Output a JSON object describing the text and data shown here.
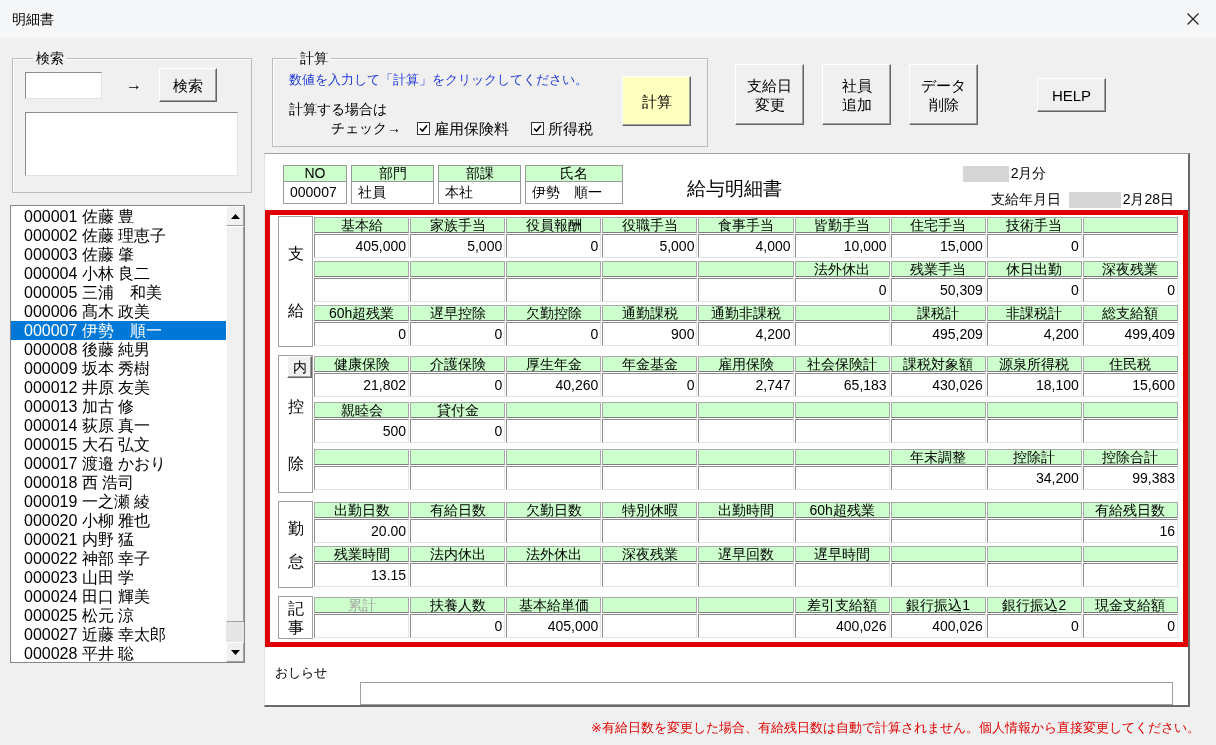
{
  "window": {
    "title": "明細書"
  },
  "search": {
    "title": "検索",
    "arrow": "→",
    "button": "検索"
  },
  "employees": [
    {
      "label": "000001 佐藤 豊",
      "selected": false
    },
    {
      "label": "000002 佐藤 理恵子",
      "selected": false
    },
    {
      "label": "000003 佐藤 肇",
      "selected": false
    },
    {
      "label": "000004 小林 良二",
      "selected": false
    },
    {
      "label": "000005 三浦　和美",
      "selected": false
    },
    {
      "label": "000006 髙木 政美",
      "selected": false
    },
    {
      "label": "000007 伊勢　順一",
      "selected": true
    },
    {
      "label": "000008 後藤 純男",
      "selected": false
    },
    {
      "label": "000009 坂本 秀樹",
      "selected": false
    },
    {
      "label": "000012 井原 友美",
      "selected": false
    },
    {
      "label": "000013 加古 修",
      "selected": false
    },
    {
      "label": "000014 荻原 真一",
      "selected": false
    },
    {
      "label": "000015 大石 弘文",
      "selected": false
    },
    {
      "label": "000017 渡邉 かおり",
      "selected": false
    },
    {
      "label": "000018 西 浩司",
      "selected": false
    },
    {
      "label": "000019 一之瀬 綾",
      "selected": false
    },
    {
      "label": "000020 小柳 雅也",
      "selected": false
    },
    {
      "label": "000021 内野 猛",
      "selected": false
    },
    {
      "label": "000022 神部 幸子",
      "selected": false
    },
    {
      "label": "000023 山田 学",
      "selected": false
    },
    {
      "label": "000024 田口 輝美",
      "selected": false
    },
    {
      "label": "000025 松元 涼",
      "selected": false
    },
    {
      "label": "000027 近藤 幸太郎",
      "selected": false
    },
    {
      "label": "000028 平井 聡",
      "selected": false
    }
  ],
  "calc": {
    "title": "計算",
    "instruction": "数値を入力して「計算」をクリックしてください。",
    "note": [
      "計算する場合は",
      "チェック→"
    ],
    "checkboxes": [
      {
        "label": "雇用保険料",
        "checked": true
      },
      {
        "label": "所得税",
        "checked": true
      }
    ],
    "button": "計算"
  },
  "toolbar": [
    {
      "lines": [
        "支給日",
        "変更"
      ]
    },
    {
      "lines": [
        "社員",
        "追加"
      ]
    },
    {
      "lines": [
        "データ",
        "削除"
      ]
    }
  ],
  "help_button": "HELP",
  "slip": {
    "info": [
      {
        "label": "NO",
        "value": "000007"
      },
      {
        "label": "部門",
        "value": "社員"
      },
      {
        "label": "部課",
        "value": "本社"
      },
      {
        "label": "氏名",
        "value": "伊勢　順一"
      }
    ],
    "title": "給与明細書",
    "period": "2月分",
    "pay_date_label": "支給年月日",
    "pay_date": "2月28日",
    "sections": [
      {
        "label": "支給",
        "rows": [
          [
            {
              "label": "基本給",
              "value": "405,000"
            },
            {
              "label": "家族手当",
              "value": "5,000"
            },
            {
              "label": "役員報酬",
              "value": "0"
            },
            {
              "label": "役職手当",
              "value": "5,000"
            },
            {
              "label": "食事手当",
              "value": "4,000"
            },
            {
              "label": "皆勤手当",
              "value": "10,000"
            },
            {
              "label": "住宅手当",
              "value": "15,000"
            },
            {
              "label": "技術手当",
              "value": "0"
            },
            {}
          ],
          [
            {},
            {},
            {},
            {},
            {},
            {
              "label": "法外休出",
              "value": "0"
            },
            {
              "label": "残業手当",
              "value": "50,309"
            },
            {
              "label": "休日出勤",
              "value": "0"
            },
            {
              "label": "深夜残業",
              "value": "0"
            }
          ],
          [
            {
              "label": "60h超残業",
              "value": "0"
            },
            {
              "label": "遅早控除",
              "value": "0"
            },
            {
              "label": "欠勤控除",
              "value": "0"
            },
            {
              "label": "通勤課税",
              "value": "900"
            },
            {
              "label": "通勤非課税",
              "value": "4,200"
            },
            {},
            {
              "label": "課税計",
              "value": "495,209"
            },
            {
              "label": "非課税計",
              "value": "4,200"
            },
            {
              "label": "総支給額",
              "value": "499,409"
            }
          ]
        ]
      },
      {
        "label": "控除",
        "side_button": "内",
        "rows": [
          [
            {
              "label": "健康保険",
              "value": "21,802"
            },
            {
              "label": "介護保険",
              "value": "0"
            },
            {
              "label": "厚生年金",
              "value": "40,260"
            },
            {
              "label": "年金基金",
              "value": "0"
            },
            {
              "label": "雇用保険",
              "value": "2,747"
            },
            {
              "label": "社会保険計",
              "value": "65,183"
            },
            {
              "label": "課税対象額",
              "value": "430,026"
            },
            {
              "label": "源泉所得税",
              "value": "18,100"
            },
            {
              "label": "住民税",
              "value": "15,600"
            }
          ],
          [
            {
              "label": "親睦会",
              "value": "500"
            },
            {
              "label": "貸付金",
              "value": "0"
            },
            {},
            {},
            {},
            {},
            {},
            {},
            {}
          ],
          [
            {},
            {},
            {},
            {},
            {},
            {},
            {
              "label": "年末調整"
            },
            {
              "label": "控除計",
              "value": "34,200"
            },
            {
              "label": "控除合計",
              "value": "99,383"
            }
          ]
        ]
      },
      {
        "label": "勤怠",
        "rows": [
          [
            {
              "label": "出勤日数",
              "value": "20.00"
            },
            {
              "label": "有給日数"
            },
            {
              "label": "欠勤日数"
            },
            {
              "label": "特別休暇"
            },
            {
              "label": "出勤時間"
            },
            {
              "label": "60h超残業"
            },
            {},
            {},
            {
              "label": "有給残日数",
              "value": "16"
            }
          ],
          [
            {
              "label": "残業時間",
              "value": "13.15"
            },
            {
              "label": "法内休出"
            },
            {
              "label": "法外休出"
            },
            {
              "label": "深夜残業"
            },
            {
              "label": "遅早回数"
            },
            {
              "label": "遅早時間"
            },
            {},
            {},
            {}
          ]
        ]
      },
      {
        "label": "記事",
        "rows": [
          [
            {
              "label": "累計",
              "disabled": true
            },
            {
              "label": "扶養人数",
              "value": "0",
              "disabled": false
            },
            {
              "label": "基本給単価",
              "value": "405,000",
              "disabled": false
            },
            {},
            {},
            {
              "label": "差引支給額",
              "value": "400,026",
              "disabled": false
            },
            {
              "label": "銀行振込1",
              "value": "400,026",
              "disabled": false
            },
            {
              "label": "銀行振込2",
              "value": "0",
              "disabled": false
            },
            {
              "label": "現金支給額",
              "value": "0",
              "disabled": false
            }
          ]
        ]
      }
    ],
    "notice_label": "おしらせ"
  },
  "footer_note": "※有給日数を変更した場合、有給残日数は自動で計算されません。個人情報から直接変更してください。"
}
